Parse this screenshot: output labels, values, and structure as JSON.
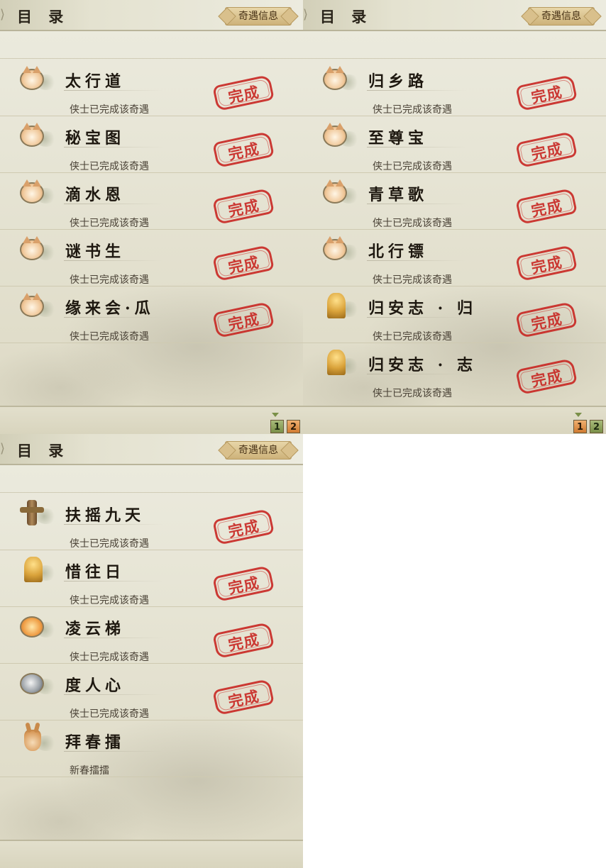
{
  "panels": [
    {
      "title": "目 录",
      "info_button": "奇遇信息",
      "rows": [
        {
          "icon": "cat-icon",
          "name": "太行道",
          "status": "侠士已完成该奇遇",
          "stamp": "完成"
        },
        {
          "icon": "cat-icon",
          "name": "秘宝图",
          "status": "侠士已完成该奇遇",
          "stamp": "完成"
        },
        {
          "icon": "cat-icon",
          "name": "滴水恩",
          "status": "侠士已完成该奇遇",
          "stamp": "完成"
        },
        {
          "icon": "cat-icon",
          "name": "谜书生",
          "status": "侠士已完成该奇遇",
          "stamp": "完成"
        },
        {
          "icon": "cat-icon",
          "name": "缘来会·瓜",
          "status": "侠士已完成该奇遇",
          "stamp": "完成"
        }
      ],
      "pager": {
        "pages": [
          "1",
          "2"
        ],
        "current": "1"
      }
    },
    {
      "title": "目 录",
      "info_button": "奇遇信息",
      "rows": [
        {
          "icon": "cat-icon",
          "name": "归乡路",
          "status": "侠士已完成该奇遇",
          "stamp": "完成"
        },
        {
          "icon": "cat-icon",
          "name": "至尊宝",
          "status": "侠士已完成该奇遇",
          "stamp": "完成"
        },
        {
          "icon": "cat-icon",
          "name": "青草歌",
          "status": "侠士已完成该奇遇",
          "stamp": "完成"
        },
        {
          "icon": "cat-icon",
          "name": "北行镖",
          "status": "侠士已完成该奇遇",
          "stamp": "完成"
        },
        {
          "icon": "buddha-icon",
          "name": "归安志 · 归",
          "status": "侠士已完成该奇遇",
          "stamp": "完成"
        },
        {
          "icon": "buddha-icon",
          "name": "归安志 · 志",
          "status": "侠士已完成该奇遇",
          "stamp": "完成"
        }
      ],
      "pager": {
        "pages": [
          "1",
          "2"
        ],
        "current": "2"
      }
    },
    {
      "title": "目 录",
      "info_button": "奇遇信息",
      "rows": [
        {
          "icon": "staff-icon",
          "name": "扶摇九天",
          "status": "侠士已完成该奇遇",
          "stamp": "完成"
        },
        {
          "icon": "buddha-icon",
          "name": "惜往日",
          "status": "侠士已完成该奇遇",
          "stamp": "完成"
        },
        {
          "icon": "fire-icon",
          "name": "凌云梯",
          "status": "侠士已完成该奇遇",
          "stamp": "完成"
        },
        {
          "icon": "mask-icon",
          "name": "度人心",
          "status": "侠士已完成该奇遇",
          "stamp": "完成"
        },
        {
          "icon": "deer-icon",
          "name": "拜春擂",
          "status": "新春擂擂",
          "stamp": ""
        }
      ],
      "pager": null
    }
  ]
}
